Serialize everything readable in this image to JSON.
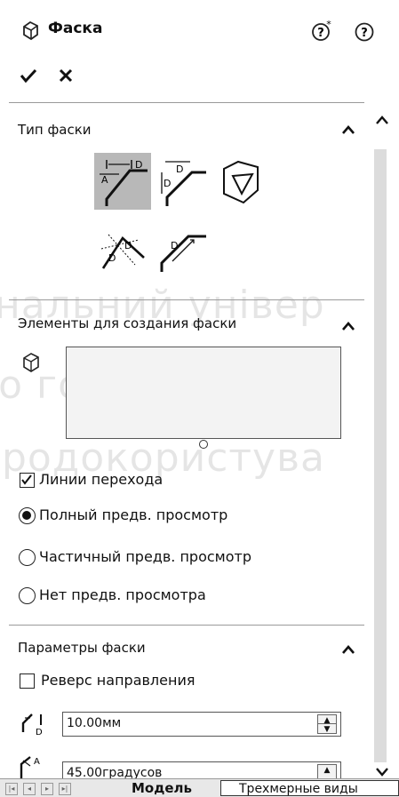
{
  "header": {
    "title": "Фаска",
    "ok_symbol": "✔",
    "cancel_symbol": "✕",
    "help_icon_1": "?*",
    "help_icon_2": "?"
  },
  "chamfer_type": {
    "title": "Тип фаски",
    "buttons": [
      "angle-distance",
      "distance-distance",
      "vertex",
      "offset-face",
      "face-face"
    ],
    "selected": "angle-distance"
  },
  "elements": {
    "title": "Элементы для создания фаски"
  },
  "options": {
    "tangent_propagation": {
      "label": "Линии перехода",
      "checked": true
    },
    "full_preview": {
      "label": "Полный предв. просмотр",
      "selected": true
    },
    "partial_preview": {
      "label": "Частичный предв. просмотр",
      "selected": false
    },
    "no_preview": {
      "label": "Нет предв. просмотра",
      "selected": false
    }
  },
  "parameters": {
    "title": "Параметры фаски",
    "reverse": {
      "label": "Реверс направления",
      "checked": false
    },
    "distance_value": "10.00мм",
    "angle_value": "45.00градусов"
  },
  "bottom_tabs": {
    "model": "Модель",
    "views_3d": "Трехмерные виды"
  },
  "watermark": {
    "line1": "нальний універ",
    "line2": "го господарств",
    "line3": "родокористува"
  }
}
